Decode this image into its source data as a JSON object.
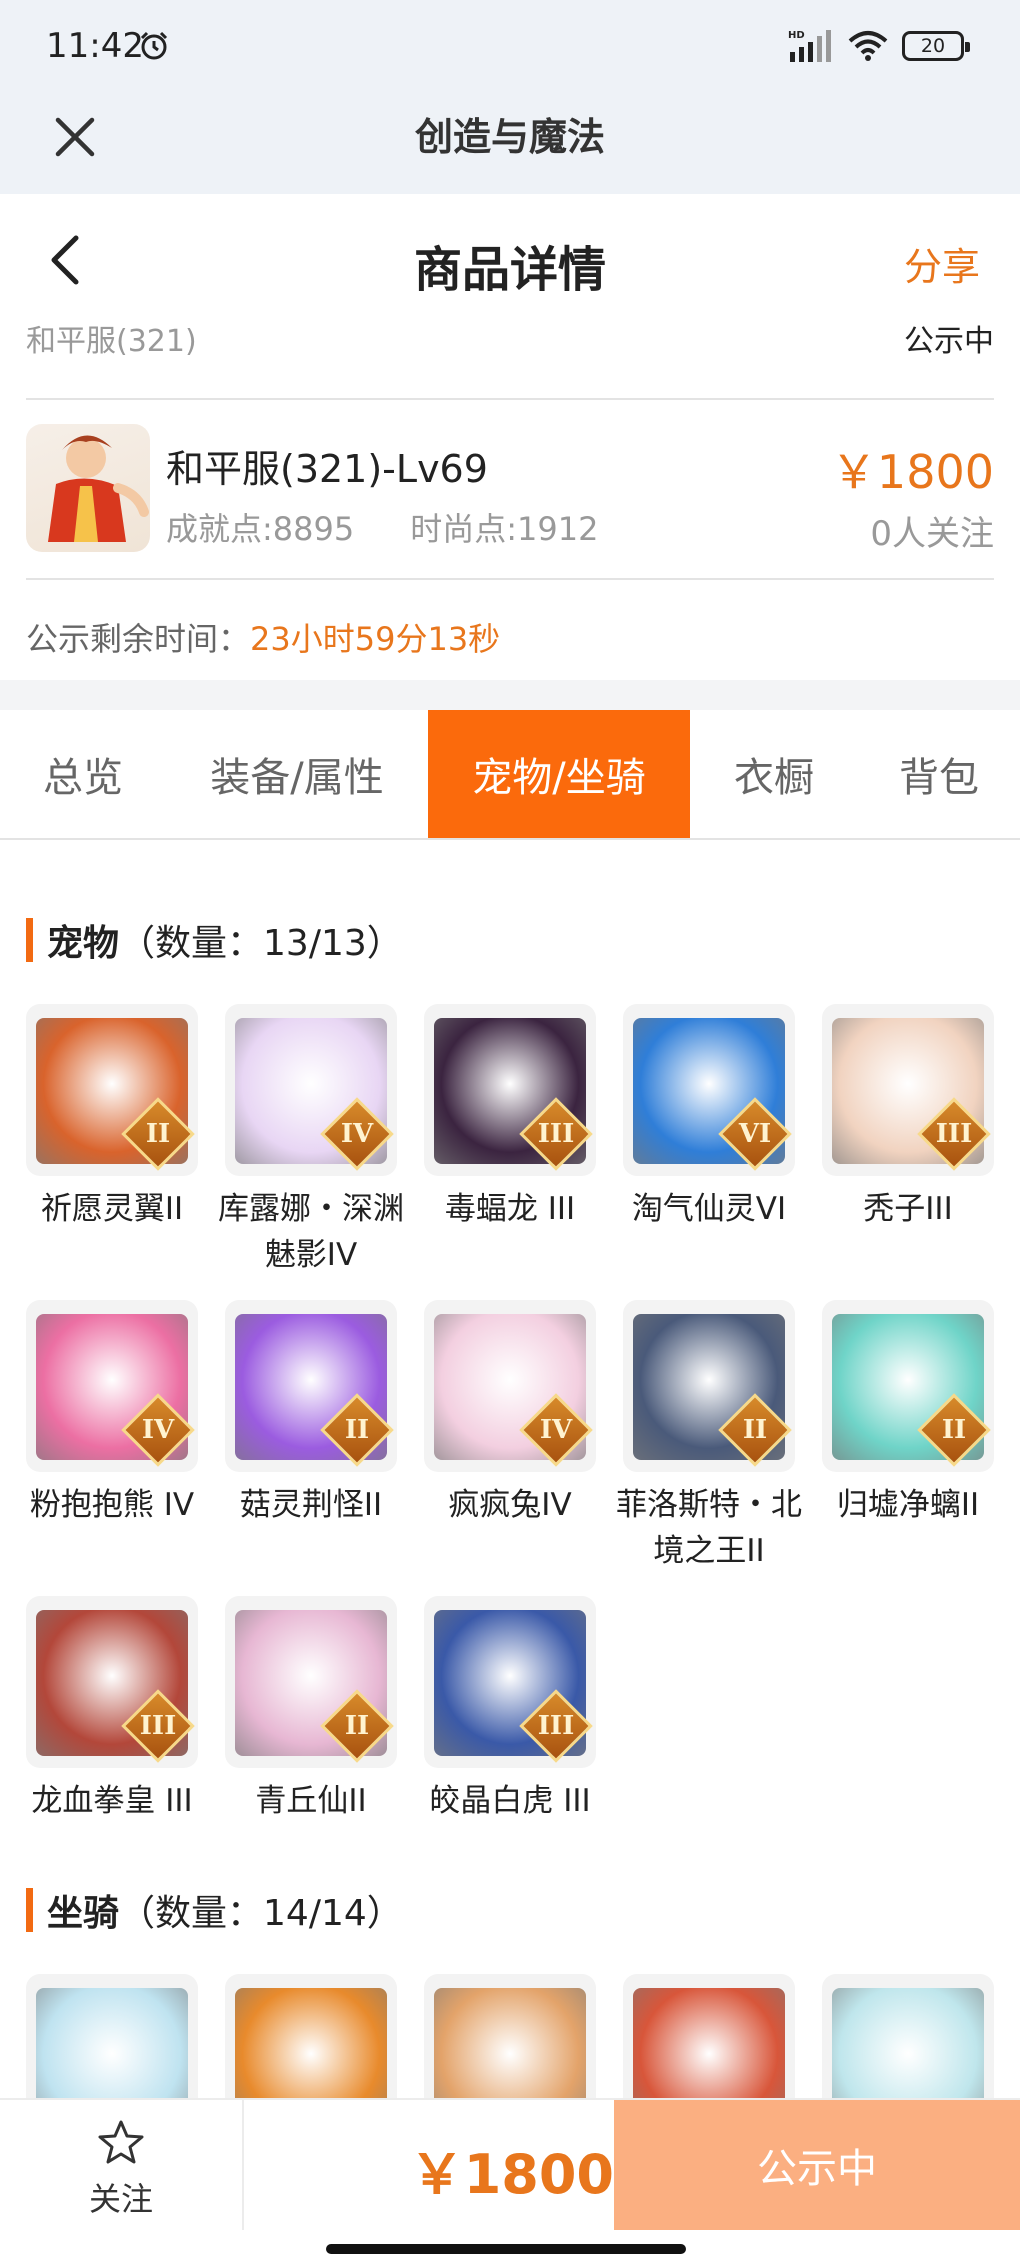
{
  "status_bar": {
    "time": "11:42",
    "battery": "20",
    "network_badge": "HD"
  },
  "app": {
    "title": "创造与魔法"
  },
  "page": {
    "title": "商品详情",
    "share_label": "分享"
  },
  "listing": {
    "server": "和平服(321)",
    "status": "公示中",
    "name": "和平服(321)-Lv69",
    "achievement": "成就点:8895",
    "fashion": "时尚点:1912",
    "price": "￥1800",
    "followers": "0人关注",
    "countdown_label": "公示剩余时间：",
    "countdown_value": "23小时59分13秒"
  },
  "tabs": [
    {
      "label": "总览",
      "active": false
    },
    {
      "label": "装备/属性",
      "active": false
    },
    {
      "label": "宠物/坐骑",
      "active": true
    },
    {
      "label": "衣橱",
      "active": false
    },
    {
      "label": "背包",
      "active": false
    }
  ],
  "pets": {
    "title": "宠物",
    "count": "（数量：13/13）",
    "items": [
      {
        "name": "祈愿灵翼II",
        "rank": "II",
        "color": "#d9632c"
      },
      {
        "name": "库露娜・深渊魅影IV",
        "rank": "IV",
        "color": "#e8d6f4"
      },
      {
        "name": "毒蝠龙 III",
        "rank": "III",
        "color": "#3b2440"
      },
      {
        "name": "淘气仙灵VI",
        "rank": "VI",
        "color": "#2f7ed8"
      },
      {
        "name": "秃子III",
        "rank": "III",
        "color": "#f1d3c0"
      },
      {
        "name": "粉抱抱熊 IV",
        "rank": "IV",
        "color": "#ec6fa3"
      },
      {
        "name": "菇灵荆怪II",
        "rank": "II",
        "color": "#9b5ce0"
      },
      {
        "name": "疯疯兔IV",
        "rank": "IV",
        "color": "#f3cfe0"
      },
      {
        "name": "菲洛斯特・北境之王II",
        "rank": "II",
        "color": "#4a5a7a"
      },
      {
        "name": "归墟净螭II",
        "rank": "II",
        "color": "#6fd4c8"
      },
      {
        "name": "龙血拳皇 III",
        "rank": "III",
        "color": "#b3473a"
      },
      {
        "name": "青丘仙II",
        "rank": "II",
        "color": "#e7b7d3"
      },
      {
        "name": "皎晶白虎 III",
        "rank": "III",
        "color": "#3a59a8"
      }
    ]
  },
  "mounts": {
    "title": "坐骑",
    "count": "（数量：14/14）",
    "items": [
      {
        "color": "#bfe3f0"
      },
      {
        "color": "#e88a2c"
      },
      {
        "color": "#e3a36a"
      },
      {
        "color": "#d8563a"
      },
      {
        "color": "#bfe6ec"
      }
    ]
  },
  "bottom": {
    "follow_label": "关注",
    "price": "￥1800",
    "status_label": "公示中"
  }
}
